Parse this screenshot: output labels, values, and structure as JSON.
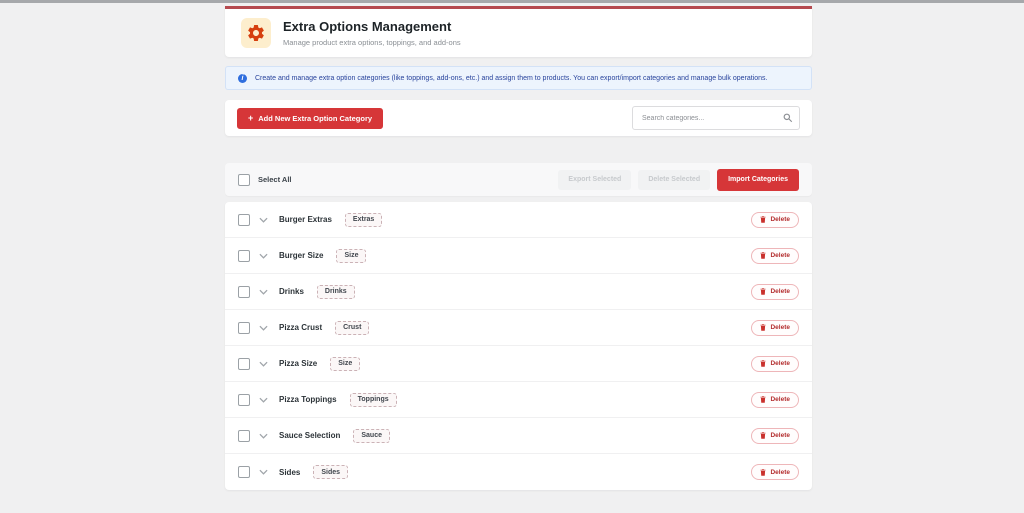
{
  "page": {
    "top_strip_color": "#a6a8ab",
    "background": "#f0f0f1",
    "accent_red": "#d63638",
    "header_border_red": "#b5494f"
  },
  "header": {
    "title": "Extra Options Management",
    "subtitle": "Manage product extra options, toppings, and add-ons",
    "icon": "gear-icon",
    "icon_color": "#d63f0e",
    "icon_bg": "#fdeecd"
  },
  "banner": {
    "icon": "info-icon",
    "icon_color": "#2f6ede",
    "text": "Create and manage extra option categories (like toppings, add-ons, etc.) and assign them to products. You can export/import categories and manage bulk operations.",
    "bg": "#edf4fd"
  },
  "actions": {
    "add_button_plus": "+",
    "add_button_label": "Add New Extra Option Category",
    "search_placeholder": "Search categories...",
    "search_icon": "magnifier-icon"
  },
  "toolbar": {
    "select_all_label": "Select All",
    "export_selected_label": "Export Selected",
    "delete_selected_label": "Delete Selected",
    "import_categories_label": "Import Categories",
    "export_delete_disabled": true
  },
  "list": {
    "delete_label": "Delete",
    "rows": [
      {
        "name": "Burger Extras",
        "badge": "Extras"
      },
      {
        "name": "Burger Size",
        "badge": "Size"
      },
      {
        "name": "Drinks",
        "badge": "Drinks"
      },
      {
        "name": "Pizza Crust",
        "badge": "Crust"
      },
      {
        "name": "Pizza Size",
        "badge": "Size"
      },
      {
        "name": "Pizza Toppings",
        "badge": "Toppings"
      },
      {
        "name": "Sauce Selection",
        "badge": "Sauce"
      },
      {
        "name": "Sides",
        "badge": "Sides"
      }
    ]
  }
}
